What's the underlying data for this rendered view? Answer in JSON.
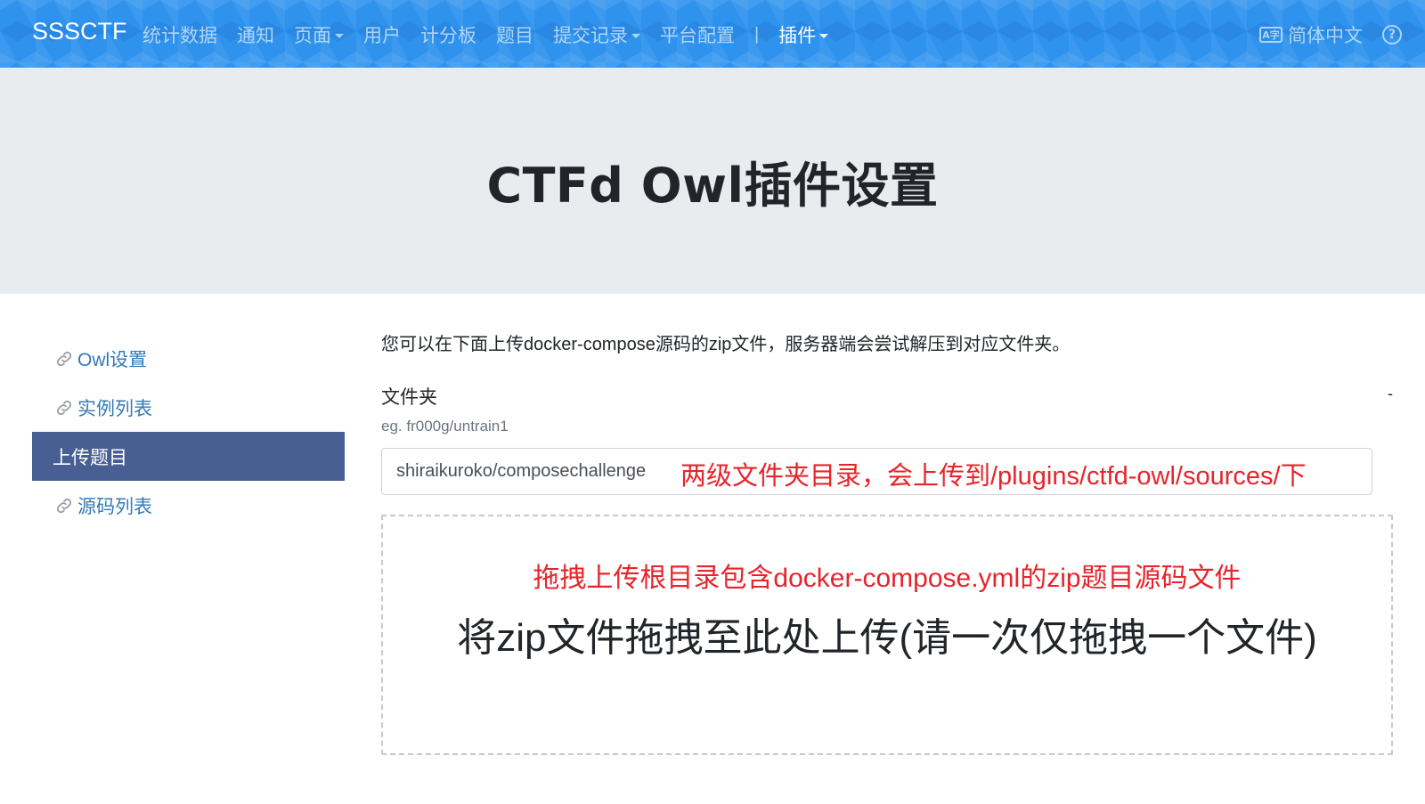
{
  "navbar": {
    "brand": "SSSCTF",
    "items": [
      {
        "label": "统计数据",
        "dropdown": false
      },
      {
        "label": "通知",
        "dropdown": false
      },
      {
        "label": "页面",
        "dropdown": true
      },
      {
        "label": "用户",
        "dropdown": false
      },
      {
        "label": "计分板",
        "dropdown": false
      },
      {
        "label": "题目",
        "dropdown": false
      },
      {
        "label": "提交记录",
        "dropdown": true
      },
      {
        "label": "平台配置",
        "dropdown": false
      }
    ],
    "separator": "|",
    "plugins_label": "插件",
    "language_icon_text": "A字",
    "language_label": "简体中文",
    "help_icon_text": "?"
  },
  "jumbotron": {
    "title": "CTFd Owl插件设置"
  },
  "sidebar": {
    "items": [
      {
        "label": "Owl设置",
        "active": false
      },
      {
        "label": "实例列表",
        "active": false
      },
      {
        "label": "上传题目",
        "active": true
      },
      {
        "label": "源码列表",
        "active": false
      }
    ]
  },
  "main": {
    "intro": "您可以在下面上传docker-compose源码的zip文件，服务器端会尝试解压到对应文件夹。",
    "folder_label": "文件夹",
    "folder_dash": "-",
    "folder_hint": "eg. fr000g/untrain1",
    "folder_value": "shiraikuroko/composechallenge",
    "folder_annotation": "两级文件夹目录，会上传到/plugins/ctfd-owl/sources/下",
    "drop_annotation": "拖拽上传根目录包含docker-compose.yml的zip题目源码文件",
    "drop_text": "将zip文件拖拽至此处上传(请一次仅拖拽一个文件)"
  },
  "colors": {
    "navbar_bg": "#2f93ee",
    "jumbotron_bg": "#e9ecef",
    "sidebar_active_bg": "#475f92",
    "link": "#337ab7",
    "annotation_red": "#e8242b"
  }
}
